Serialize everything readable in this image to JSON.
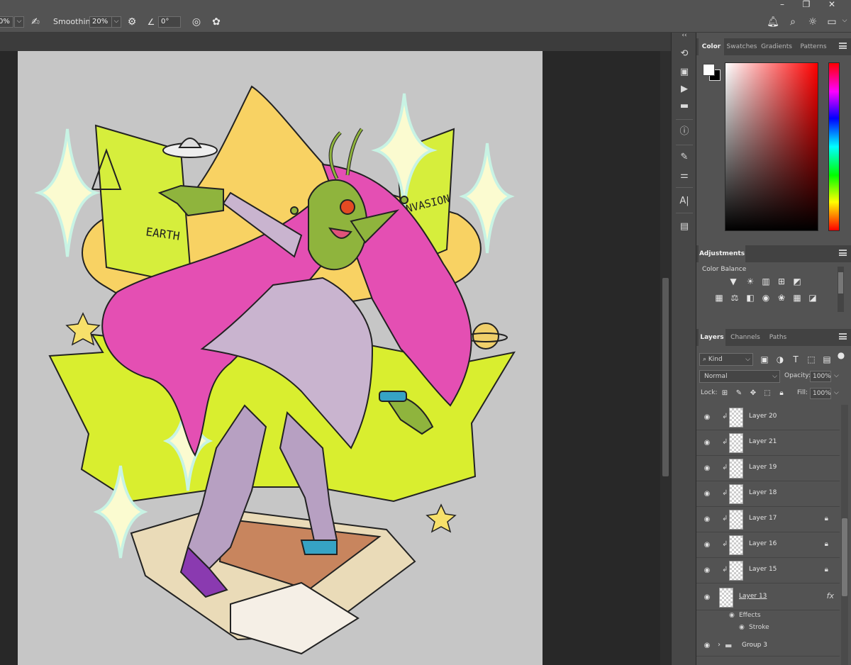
{
  "options_bar": {
    "flow_value": "0%",
    "smoothing_label": "Smoothing:",
    "smoothing_value": "20%",
    "angle_value": "0°"
  },
  "color_panel": {
    "tabs": [
      "Color",
      "Swatches",
      "Gradients",
      "Patterns"
    ],
    "active_tab": "Color",
    "foreground_color": "#ffffff",
    "background_color": "#000000",
    "field_hue": "#ff0000"
  },
  "adjustments_panel": {
    "tab": "Adjustments",
    "hover_label": "Color Balance"
  },
  "layers_panel": {
    "tabs": [
      "Layers",
      "Channels",
      "Paths"
    ],
    "active_tab": "Layers",
    "filter_kind": "Kind",
    "blend_mode": "Normal",
    "opacity_label": "Opacity:",
    "opacity_value": "100%",
    "lock_label": "Lock:",
    "fill_label": "Fill:",
    "fill_value": "100%",
    "layers": [
      {
        "name": "Layer 20",
        "locked": false
      },
      {
        "name": "Layer 21",
        "locked": false
      },
      {
        "name": "Layer 19",
        "locked": false
      },
      {
        "name": "Layer 18",
        "locked": false
      },
      {
        "name": "Layer 17",
        "locked": true
      },
      {
        "name": "Layer 16",
        "locked": true
      },
      {
        "name": "Layer 15",
        "locked": true
      }
    ],
    "layer13": {
      "name": "Layer 13",
      "fx": "fx",
      "effects_label": "Effects",
      "stroke_label": "Stroke"
    },
    "group": {
      "name": "Group 3"
    }
  },
  "artwork": {
    "sign_text_left": "EARTH",
    "sign_text_right": "INVASION"
  }
}
